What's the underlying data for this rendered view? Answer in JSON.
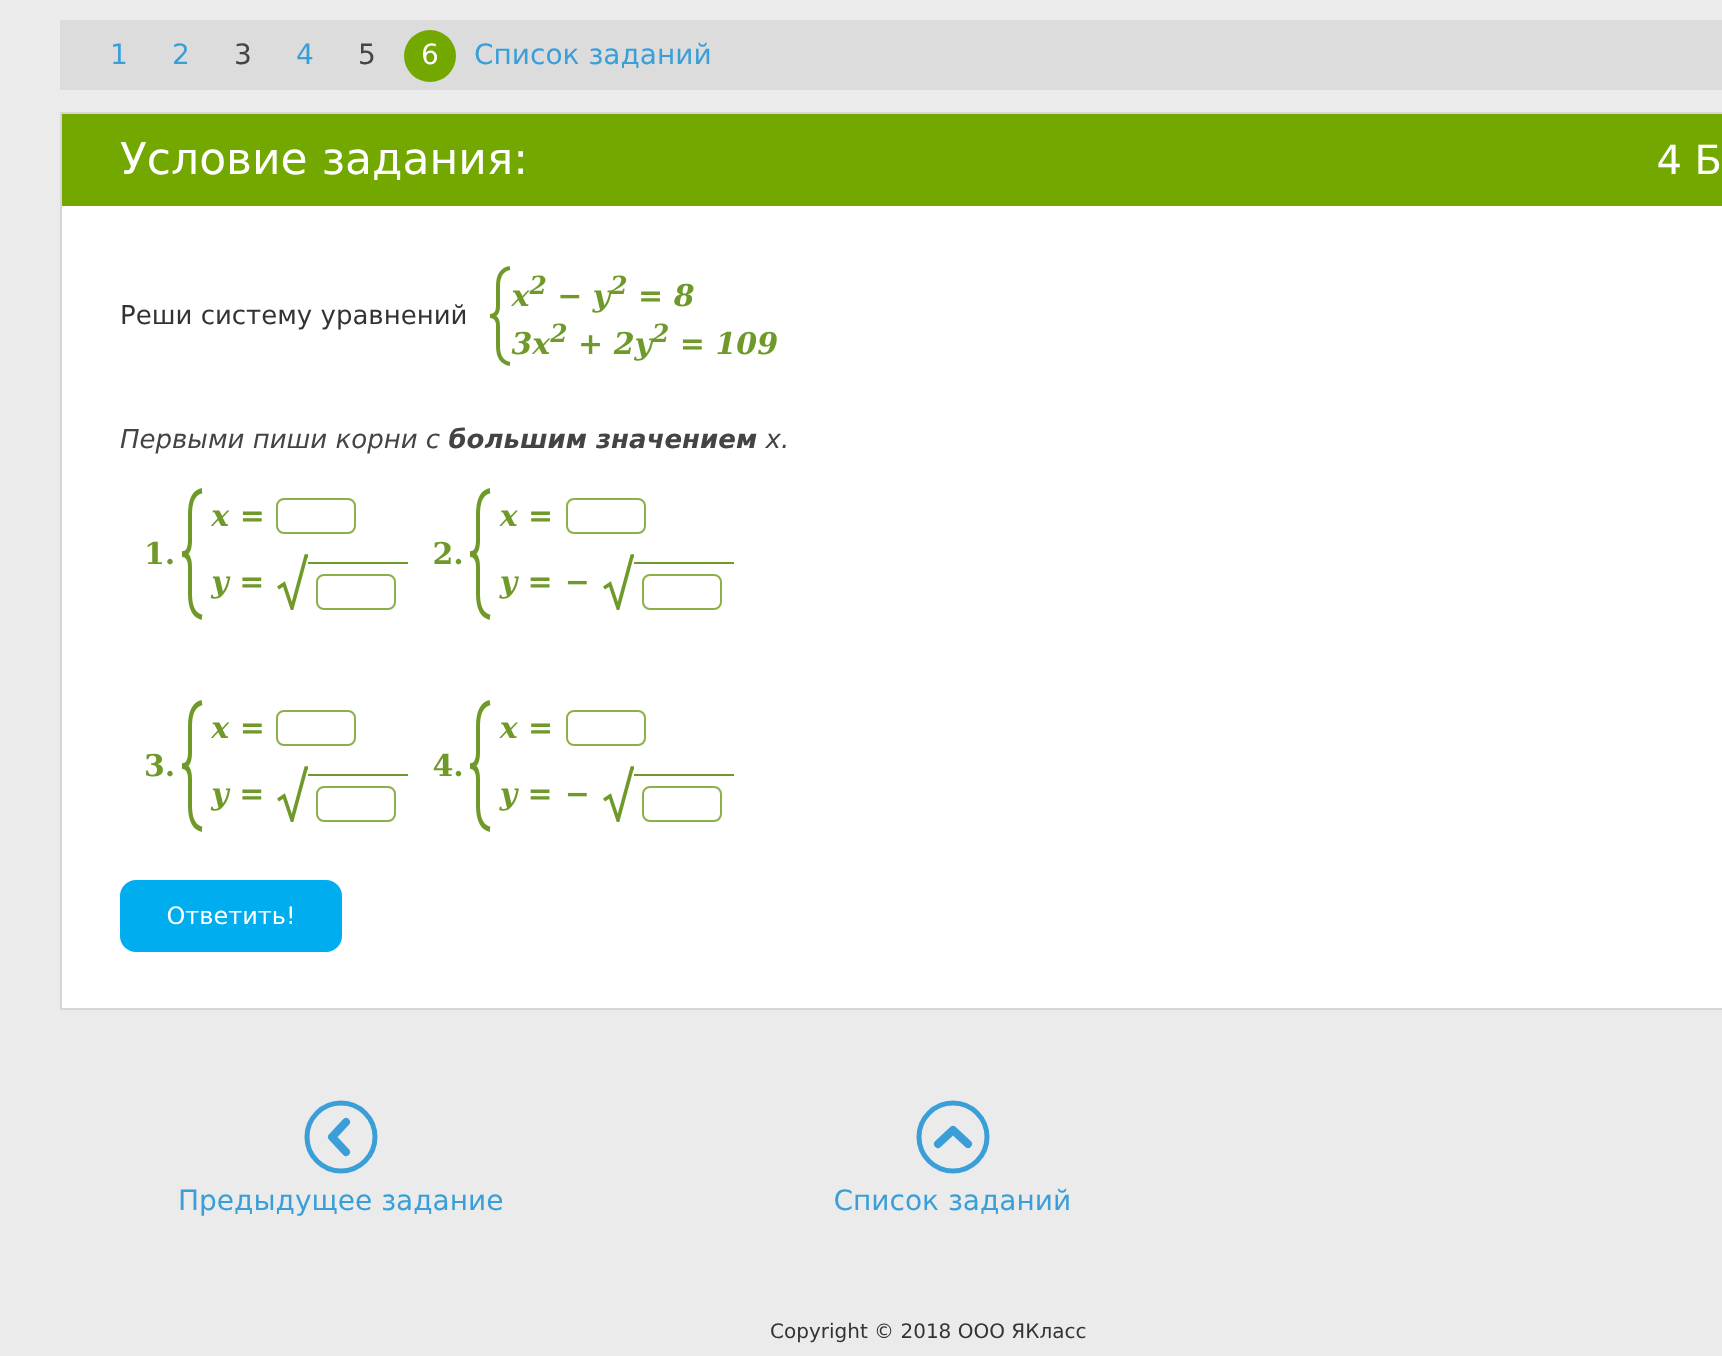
{
  "pager": {
    "pages": [
      {
        "label": "1",
        "selected": false,
        "done": false
      },
      {
        "label": "2",
        "selected": false,
        "done": false
      },
      {
        "label": "3",
        "selected": false,
        "done": true
      },
      {
        "label": "4",
        "selected": false,
        "done": false
      },
      {
        "label": "5",
        "selected": false,
        "done": true
      },
      {
        "label": "6",
        "selected": true,
        "done": false
      }
    ],
    "list_link": "Список заданий"
  },
  "task": {
    "title": "Условие задания:",
    "points": "4 Б",
    "prompt": "Реши систему уравнений",
    "equations": [
      "x$^{2}$ − y$^{2}$ = 8",
      "3x$^{2}$ + 2y$^{2}$ = 109"
    ],
    "instruction": "Первыми пиши корни с **большим значением** *x*.",
    "answers": [
      {
        "number": "1.",
        "x_label": "x =",
        "y_label": "y ="
      },
      {
        "number": "2.",
        "x_label": "x =",
        "y_label": "y =",
        "y_sign": "−"
      },
      {
        "number": "3.",
        "x_label": "x =",
        "y_label": "y ="
      },
      {
        "number": "4.",
        "x_label": "x =",
        "y_label": "y =",
        "y_sign": "−"
      }
    ],
    "submit": "Ответить!"
  },
  "footer_nav": [
    {
      "kind": "previous",
      "label": "Предыдущее задание"
    },
    {
      "kind": "list",
      "label": "Список заданий"
    }
  ],
  "copyright": "Copyright © 2018 ООО ЯКласс"
}
